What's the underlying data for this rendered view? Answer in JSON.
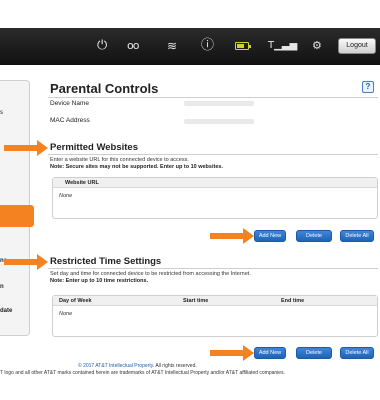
{
  "topbar": {
    "icons": [
      "power-icon",
      "voicemail-icon",
      "wifi-icon",
      "info-icon",
      "battery-icon",
      "signal-icon",
      "account-icon"
    ],
    "battery_color": "#cfd22a",
    "logout_label": "Logout"
  },
  "sidebar": {
    "fragments": [
      "s",
      "nc",
      "n",
      "date"
    ],
    "selected_color": "#f58221"
  },
  "page": {
    "title": "Parental Controls",
    "help_glyph": "?",
    "device_name_label": "Device Name",
    "mac_address_label": "MAC Address"
  },
  "permitted": {
    "title": "Permitted Websites",
    "description": "Enter a website URL for this connected device to access.",
    "note": "Note: Secure sites may not be supported. Enter up to 10 websites.",
    "column": "Website URL",
    "empty": "None",
    "buttons": {
      "add": "Add New",
      "delete": "Delete",
      "delete_all": "Delete All"
    }
  },
  "restricted": {
    "title": "Restricted Time Settings",
    "description": "Set day and time for connected device to be restricted from accessing the Internet.",
    "note": "Note: Enter up to 10 time restrictions.",
    "columns": [
      "Day of Week",
      "Start time",
      "End time"
    ],
    "empty": "None",
    "buttons": {
      "add": "Add New",
      "delete": "Delete",
      "delete_all": "Delete All"
    }
  },
  "footer": {
    "copyright": "© 2017 AT&T Intellectual Property.",
    "rights": " All rights reserved.",
    "trademark": "T logo and all other AT&T marks contained herein are trademarks of AT&T Intellectual Property and/or AT&T affiliated companies."
  },
  "accent_color": "#f58221",
  "button_color": "#1f66b9"
}
